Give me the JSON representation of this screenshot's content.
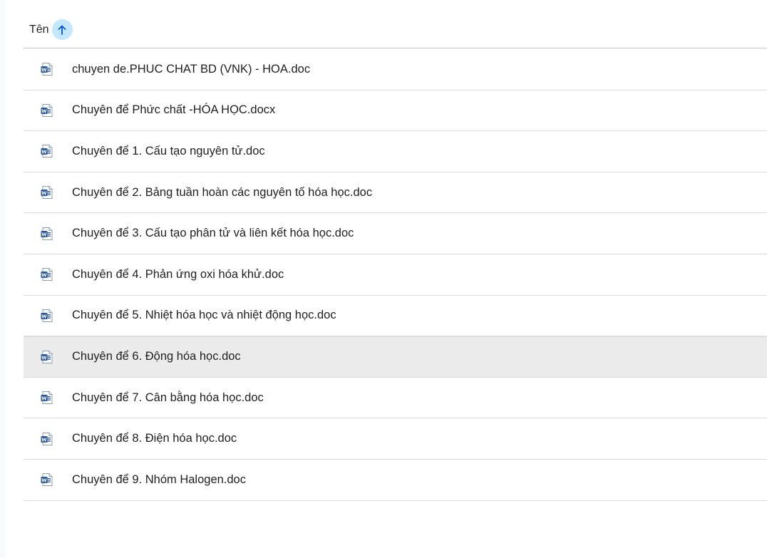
{
  "header": {
    "name_column_label": "Tên",
    "sort_icon": "arrow-up-icon"
  },
  "filter_chips": [
    {
      "label": ""
    },
    {
      "label": ""
    },
    {
      "label": ""
    },
    {
      "label": ""
    }
  ],
  "files": [
    {
      "name": "chuyen de.PHUC CHAT BD (VNK) - HOA.doc",
      "icon": "word-document-icon"
    },
    {
      "name": "Chuyên để  Phức chất -HÓA HỌC.docx",
      "icon": "word-document-icon"
    },
    {
      "name": "Chuyên để 1. Cấu tạo nguyên tử.doc",
      "icon": "word-document-icon"
    },
    {
      "name": "Chuyên để 2. Bảng tuần hoàn các nguyên tố hóa học.doc",
      "icon": "word-document-icon"
    },
    {
      "name": "Chuyên để 3. Cấu tạo phân tử và liên kết hóa học.doc",
      "icon": "word-document-icon"
    },
    {
      "name": "Chuyên để 4. Phản ứng oxi hóa khử.doc",
      "icon": "word-document-icon"
    },
    {
      "name": "Chuyên để 5. Nhiệt hóa học và nhiệt động học.doc",
      "icon": "word-document-icon"
    },
    {
      "name": "Chuyên để 6. Động hóa học.doc",
      "icon": "word-document-icon",
      "selected": true
    },
    {
      "name": "Chuyên để 7. Cân bằng hóa học.doc",
      "icon": "word-document-icon"
    },
    {
      "name": "Chuyên để 8. Điện hóa học.doc",
      "icon": "word-document-icon"
    },
    {
      "name": "Chuyên để 9. Nhóm Halogen.doc",
      "icon": "word-document-icon"
    }
  ],
  "colors": {
    "sort_button_bg": "#c2e7ff",
    "sort_arrow": "#0b57d0",
    "selected_row_bg": "#ebebeb",
    "word_blue": "#2b579a",
    "divider": "#dadce0"
  }
}
